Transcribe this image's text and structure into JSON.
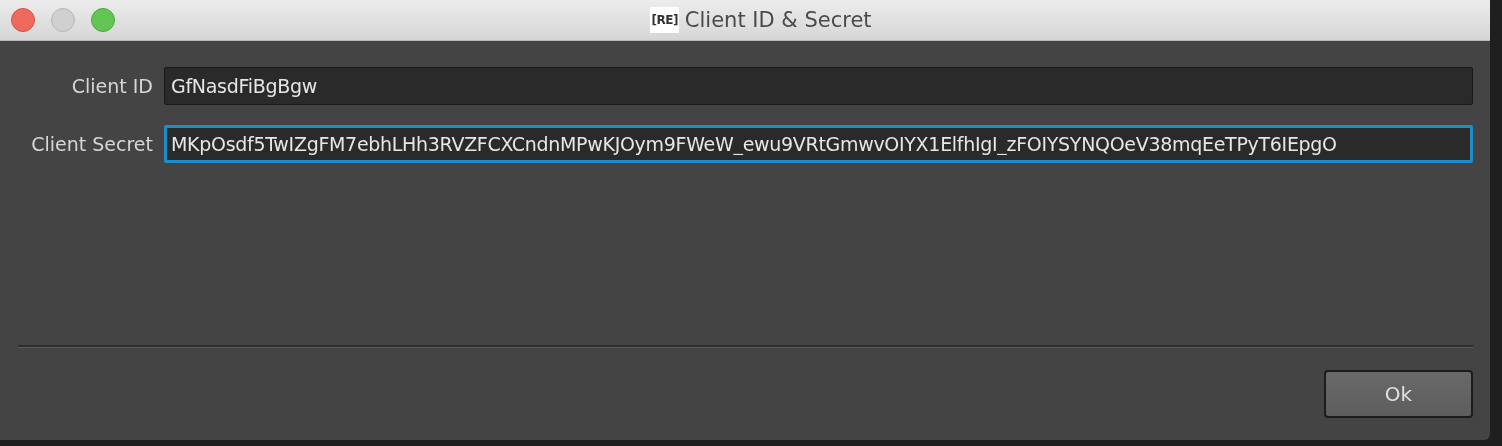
{
  "window": {
    "title": "Client ID & Secret",
    "icon_text": "[RE]"
  },
  "fields": [
    {
      "label": "Client ID",
      "value": "GfNasdFiBgBgw",
      "focused": false
    },
    {
      "label": "Client Secret",
      "value": "MKpOsdf5TwIZgFM7ebhLHh3RVZFCXCndnMPwKJOym9FWeW_ewu9VRtGmwvOIYX1ElfhIgI_zFOIYSYNQOeV38mqEeTPyT6IEpgO",
      "focused": true
    }
  ],
  "buttons": [
    "Ok"
  ]
}
